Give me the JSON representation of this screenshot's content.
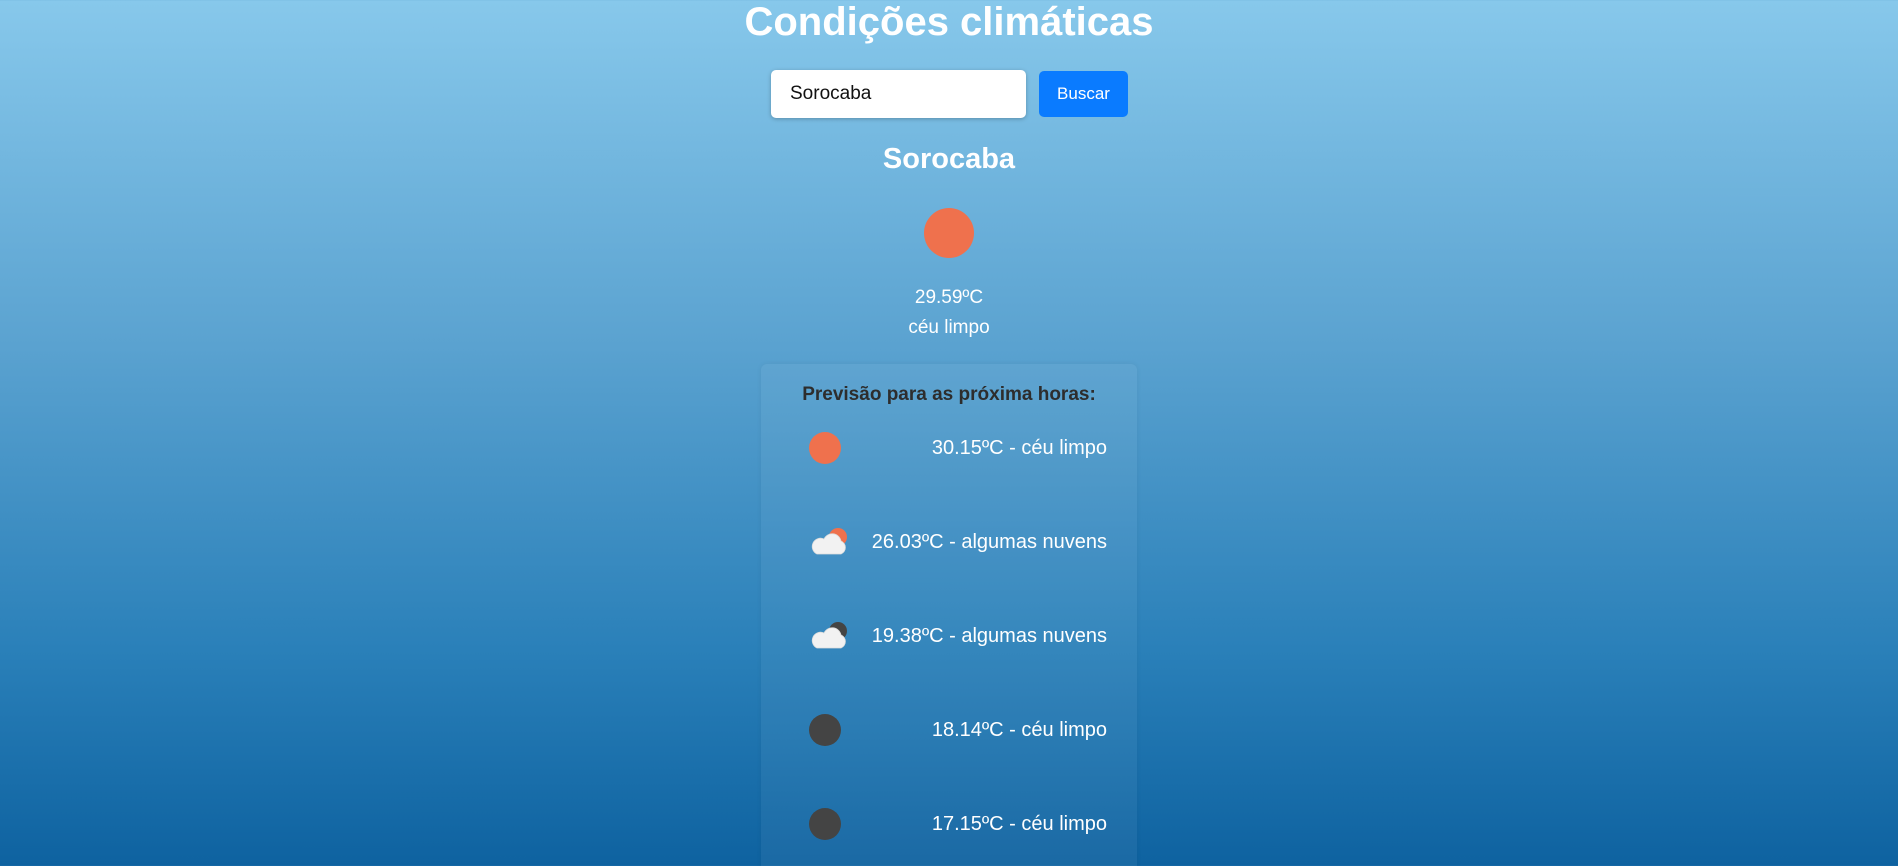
{
  "header": {
    "title": "Condições climáticas"
  },
  "search": {
    "value": "Sorocaba",
    "button_label": "Buscar"
  },
  "current": {
    "city": "Sorocaba",
    "icon": "sun-icon",
    "temperature": "29.59ºC",
    "description": "céu limpo"
  },
  "forecast": {
    "title": "Previsão para as próxima horas:",
    "items": [
      {
        "icon": "sun-icon",
        "text": "30.15ºC - céu limpo"
      },
      {
        "icon": "cloud-sun-icon",
        "text": "26.03ºC - algumas nuvens"
      },
      {
        "icon": "cloud-moon-icon",
        "text": "19.38ºC - algumas nuvens"
      },
      {
        "icon": "moon-icon",
        "text": "18.14ºC - céu limpo"
      },
      {
        "icon": "moon-icon",
        "text": "17.15ºC - céu limpo"
      }
    ]
  },
  "colors": {
    "accent": "#0a7bff",
    "sun": "#ef714d",
    "moon": "#444444"
  }
}
